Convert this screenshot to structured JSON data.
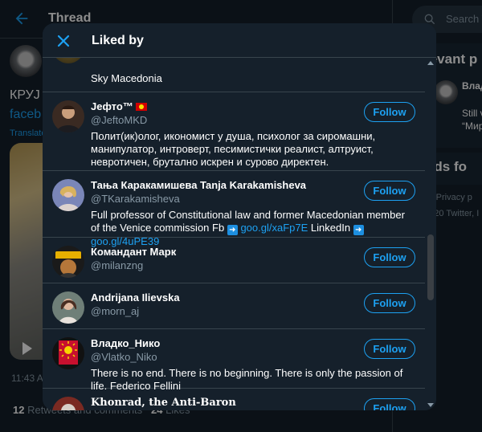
{
  "background": {
    "header_title": "Thread",
    "tweet_line1": "КРУЈ",
    "tweet_link": "faceb",
    "translate_label": "Translate",
    "time_label": "11:43 A",
    "stats": {
      "retweets_count": "12",
      "retweets_label": "Retweets and comments",
      "likes_count": "24",
      "likes_label": "Likes"
    },
    "search_placeholder": "Search T",
    "relevant_heading": "levant p",
    "suggestion_name": "Влад",
    "suggestion_line1": "Still v",
    "suggestion_line2": "“Мир",
    "trends_heading": "nds fo",
    "footer_terms": "ns   Privacy p",
    "footer_copy": "2020 Twitter, I"
  },
  "modal": {
    "title": "Liked by",
    "follow_label": "Follow",
    "partial_user": {
      "bio": "Sky Macedonia"
    },
    "users": [
      {
        "name": "Јефто™",
        "handle": "@JeftoMKD",
        "has_flag": true,
        "bio": "Полит(ик)олог, икономист у душа, психолог за сиромашни, манипулатор, интроверт, песимистички реалист, алтруист, невротичен, брутално искрен и сурово директен."
      },
      {
        "name": "Тања Каракамишева Tanja Karakamisheva",
        "handle": "@TKarakamisheva",
        "has_flag": false,
        "bio_prefix": "Full professor of Constitutional law and former Macedonian member of the Venice commission Fb",
        "link1": "goo.gl/xaFp7E",
        "bio_mid": "LinkedIn",
        "link2": "goo.gl/4uPE39"
      },
      {
        "name": "Командант Марк",
        "handle": "@milanzng",
        "has_flag": false,
        "bio": ""
      },
      {
        "name": "Andrijana Ilievska",
        "handle": "@morn_aj",
        "has_flag": false,
        "bio": ""
      },
      {
        "name": "Владко_Нико",
        "handle": "@Vlatko_Niko",
        "has_flag": false,
        "bio": "There is no end. There is no beginning. There is only the passion of life. Federico Fellini"
      },
      {
        "name": "Khonrad, the Anti-Baron",
        "handle": "",
        "has_flag": false,
        "bio": ""
      }
    ]
  }
}
